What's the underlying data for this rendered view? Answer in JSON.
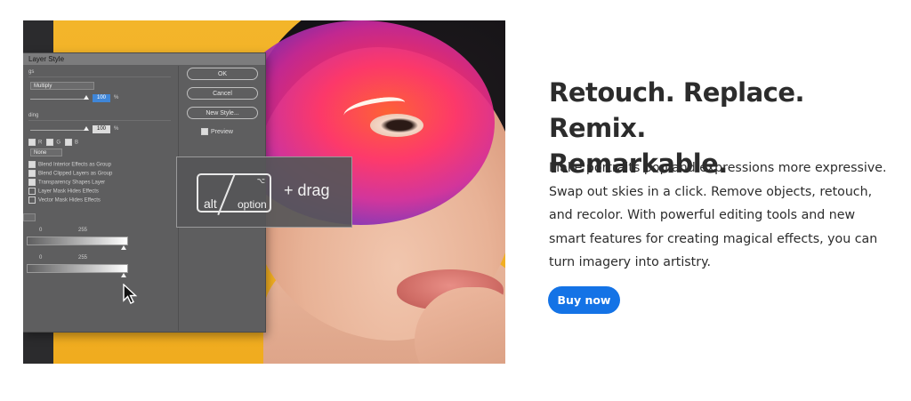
{
  "hero": {
    "heading_line1": "Retouch. Replace. Remix.",
    "heading_line2": "Remarkable.",
    "description": "Make portraits pop and expressions more expressive. Swap out skies in a click. Remove objects, retouch, and recolor. With powerful editing tools and new smart features for creating magical effects, you can turn imagery into artistry.",
    "cta_label": "Buy now",
    "cta_color": "#1473e6"
  },
  "dialog": {
    "title": "Layer Style",
    "buttons": {
      "ok": "OK",
      "cancel": "Cancel",
      "new_style": "New Style..."
    },
    "preview_label": "Preview",
    "blend_mode": "Multiply",
    "opacity_value": "100",
    "fill_value": "100",
    "percent": "%",
    "knockout": "None",
    "channel_r": "R",
    "channel_g": "G",
    "channel_b": "B",
    "options": [
      "Blend Interior Effects as Group",
      "Blend Clipped Layers as Group",
      "Transparency Shapes Layer",
      "Layer Mask Hides Effects",
      "Vector Mask Hides Effects"
    ],
    "range_min_1": "0",
    "range_max_1": "255",
    "range_min_2": "0",
    "range_max_2": "255",
    "section_blending": "gs",
    "section_advanced": "ding"
  },
  "shortcut": {
    "key_alt": "alt",
    "key_option": "option",
    "key_glyph": "⌥",
    "action": "+ drag"
  },
  "colors": {
    "accent": "#1473e6",
    "heading_text": "#2c2c2c",
    "background_yellow": "#f3b52a"
  }
}
